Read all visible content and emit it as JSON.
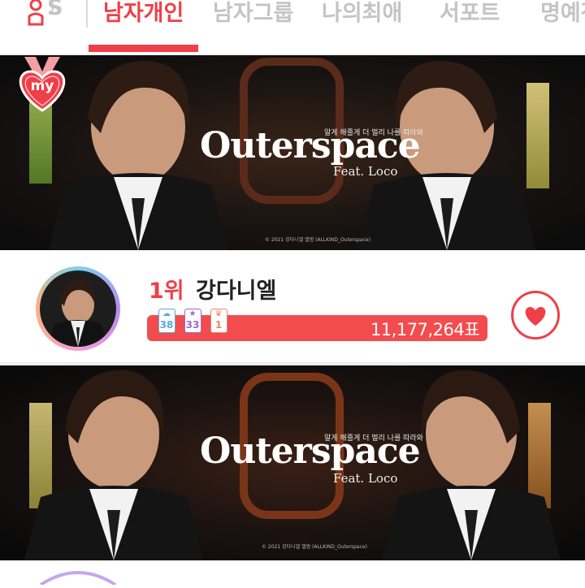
{
  "tabs": [
    {
      "label": "남자개인",
      "active": true
    },
    {
      "label": "남자그룹",
      "active": false
    },
    {
      "label": "나의최애",
      "active": false
    },
    {
      "label": "서포트",
      "active": false
    },
    {
      "label": "명예전당",
      "active": false
    }
  ],
  "tab_partial_left": "S",
  "icons": {
    "profile": "person-pin-icon",
    "my_badge": "heart-medal-icon",
    "vote": "heart-icon"
  },
  "my_badge_label": "my",
  "banner_top": {
    "title": "Outerspace",
    "tagline": "알게 해줄게 더 멀리 나를 따라와",
    "feat": "Feat. Loco",
    "copyright": "© 2021 강다니엘 앨범 (ALLKIND_Outerspace)"
  },
  "banner_bottom": {
    "title": "Outerspace",
    "tagline": "알게 해줄게 더 멀리 나를 따라와",
    "feat": "Feat. Loco",
    "copyright": "© 2021 강다니엘 앨범 (ALLKIND_Outerspace)"
  },
  "ranking": {
    "rank": "1위",
    "name": "강다니엘",
    "votes": "11,177,264표",
    "badges": [
      {
        "icon": "angel-icon",
        "value": "38",
        "color": "#5aa9d6"
      },
      {
        "icon": "star-icon",
        "value": "33",
        "color": "#9b6ad8"
      },
      {
        "icon": "crown-icon",
        "value": "1",
        "color": "#e8886a"
      }
    ]
  },
  "colors": {
    "accent": "#ef3f48",
    "bar": "#f24c4f",
    "inactive_tab": "#c4c4c4"
  }
}
